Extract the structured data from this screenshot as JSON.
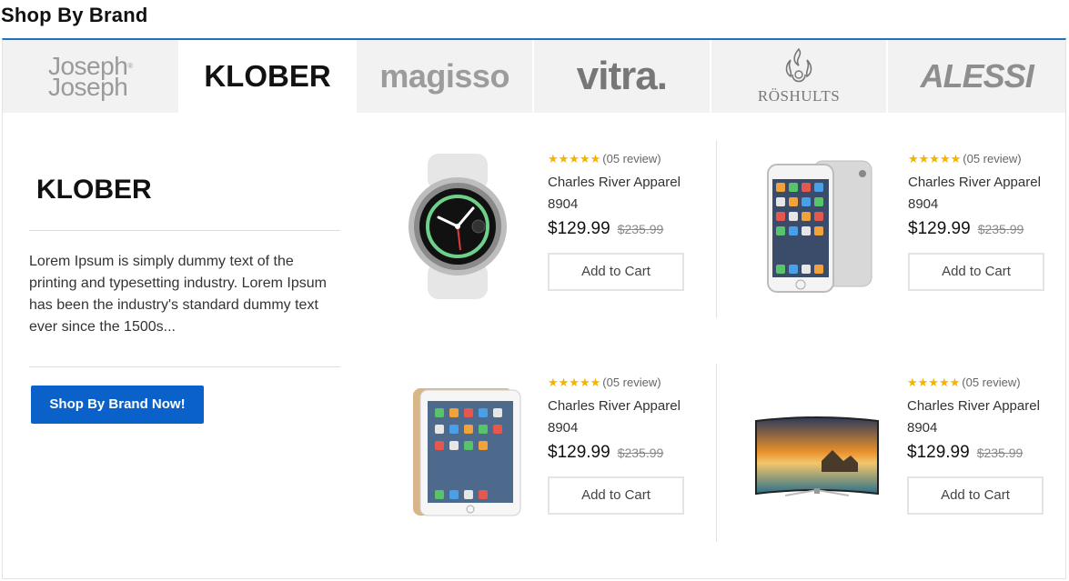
{
  "section": {
    "title": "Shop By Brand"
  },
  "brands": [
    {
      "id": "josephjoseph",
      "line1": "Joseph",
      "line2": "Joseph",
      "mark": "®"
    },
    {
      "id": "klober",
      "name": "KLOBER"
    },
    {
      "id": "magisso",
      "name": "magisso"
    },
    {
      "id": "vitra",
      "name": "vitra."
    },
    {
      "id": "roshults",
      "name": "RÖSHULTS"
    },
    {
      "id": "alessi",
      "name": "ALESSI"
    }
  ],
  "active_brand": {
    "logo": "KLOBER",
    "description": "Lorem Ipsum is simply dummy text of the printing and typesetting industry. Lorem Ipsum has been the industry's standard dummy text ever since the 1500s...",
    "cta": "Shop By Brand Now!"
  },
  "products": [
    {
      "image": "smartwatch",
      "stars": "★★★★★",
      "reviews": "(05 review)",
      "name": "Charles River Apparel 8904",
      "price": "$129.99",
      "old_price": "$235.99",
      "cta": "Add to Cart"
    },
    {
      "image": "smartphone",
      "stars": "★★★★★",
      "reviews": "(05 review)",
      "name": "Charles River Apparel 8904",
      "price": "$129.99",
      "old_price": "$235.99",
      "cta": "Add to Cart"
    },
    {
      "image": "tablet",
      "stars": "★★★★★",
      "reviews": "(05 review)",
      "name": "Charles River Apparel 8904",
      "price": "$129.99",
      "old_price": "$235.99",
      "cta": "Add to Cart"
    },
    {
      "image": "curved-tv",
      "stars": "★★★★★",
      "reviews": "(05 review)",
      "name": "Charles River Apparel 8904",
      "price": "$129.99",
      "old_price": "$235.99",
      "cta": "Add to Cart"
    }
  ],
  "colors": {
    "accent": "#1e73be",
    "button": "#0a61c9",
    "star": "#f5b301"
  }
}
